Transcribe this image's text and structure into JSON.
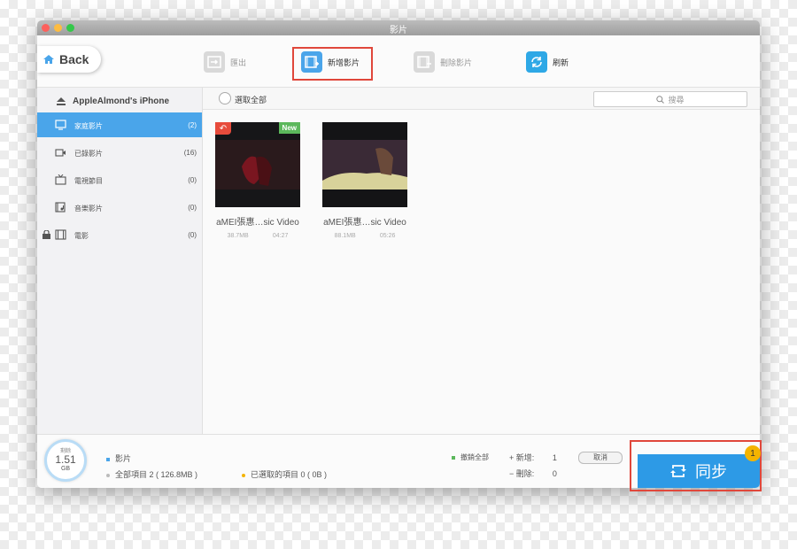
{
  "window": {
    "title": "影片",
    "traffic_lights": [
      "#fc605c",
      "#fdbc40",
      "#34c84a"
    ]
  },
  "toolbar": {
    "back_label": "Back",
    "export_label": "匯出",
    "add_label": "新增影片",
    "delete_label": "刪除影片",
    "refresh_label": "刷新",
    "accent": "#4aa5ea",
    "highlight": "#e0473b"
  },
  "sidebar": {
    "device_name": "AppleAlmond's iPhone",
    "items": [
      {
        "label": "家庭影片",
        "count": "(2)",
        "icon": "monitor-icon",
        "selected": true
      },
      {
        "label": "已錄影片",
        "count": "(16)",
        "icon": "video-camera-icon",
        "selected": false
      },
      {
        "label": "電視節目",
        "count": "(0)",
        "icon": "tv-icon",
        "selected": false
      },
      {
        "label": "音樂影片",
        "count": "(0)",
        "icon": "music-video-icon",
        "selected": false
      },
      {
        "label": "電影",
        "count": "(0)",
        "icon": "film-icon",
        "selected": false,
        "locked": true
      }
    ]
  },
  "main": {
    "select_all_label": "選取全部",
    "search_placeholder": "搜尋",
    "videos": [
      {
        "title": "aMEI張惠…sic Video",
        "size": "38.7MB",
        "duration": "04:27",
        "badge_new": "New",
        "restore": true
      },
      {
        "title": "aMEI張惠…sic Video",
        "size": "88.1MB",
        "duration": "05:26"
      }
    ]
  },
  "footer": {
    "storage_label": "剩餘",
    "storage_value": "1.51",
    "storage_unit": "GB",
    "category_label": "影片",
    "total_items": "全部項目 2 ( 126.8MB )",
    "selected_items": "已選取的項目 0 ( 0B )",
    "undo_all_label": "撤銷全部",
    "add_label": "新增:",
    "add_value": "1",
    "delete_label": "刪除:",
    "delete_value": "0",
    "cancel_label": "取消",
    "sync_label": "同步",
    "sync_badge": "1"
  }
}
